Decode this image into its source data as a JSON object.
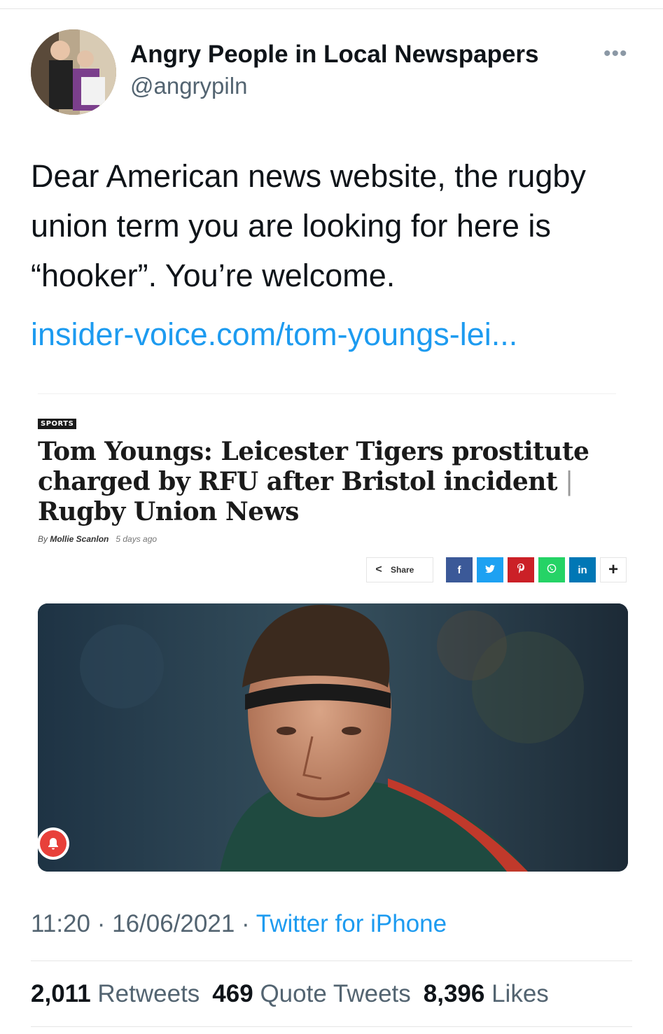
{
  "author": {
    "display_name": "Angry People in Local Newspapers",
    "handle": "@angrypiln",
    "more_icon": "more-icon"
  },
  "tweet": {
    "text": "Dear American news website, the rugby union term you are looking for here is “hooker”. You’re welcome.",
    "link": "insider-voice.com/tom-youngs-lei..."
  },
  "card": {
    "section_tag": "SPORTS",
    "headline_main": "Tom Youngs: Leicester Tigers prostitute charged by RFU after Bristol incident",
    "headline_sep": " | ",
    "headline_tail": "Rugby Union News",
    "byline_prefix": "By ",
    "author": "Mollie Scanlon",
    "age": "5 days ago",
    "share_label": "Share",
    "share_buttons": [
      {
        "name": "facebook",
        "glyph": "f",
        "color": "#3b5998"
      },
      {
        "name": "twitter",
        "glyph": "✔",
        "color": "#1da1f2"
      },
      {
        "name": "pinterest",
        "glyph": "P",
        "color": "#cb2027"
      },
      {
        "name": "whatsapp",
        "glyph": "☎",
        "color": "#25d366"
      },
      {
        "name": "linkedin",
        "glyph": "in",
        "color": "#0077b5"
      },
      {
        "name": "more",
        "glyph": "+",
        "color": "#ffffff"
      }
    ],
    "notification_icon": "bell-icon"
  },
  "meta": {
    "time": "11:20",
    "date": "16/06/2021",
    "source": "Twitter for iPhone",
    "dot": " · "
  },
  "stats": {
    "retweets_count": "2,011",
    "retweets_label": "Retweets",
    "quotes_count": "469",
    "quotes_label": "Quote Tweets",
    "likes_count": "8,396",
    "likes_label": "Likes"
  }
}
